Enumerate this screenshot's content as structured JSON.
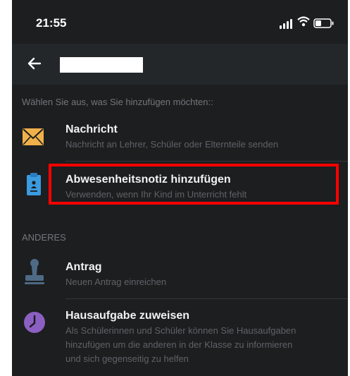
{
  "status_bar": {
    "time": "21:55"
  },
  "header": {
    "back_icon": "arrow-left-icon",
    "title_redacted": true
  },
  "prompt": "Wählen Sie aus, was Sie hinzufügen möchten::",
  "items_main": [
    {
      "title": "Nachricht",
      "subtitle": "Nachricht an Lehrer, Schüler oder Elternteile senden",
      "icon": "envelope-icon"
    },
    {
      "title": "Abwesenheitsnotiz hinzufügen",
      "subtitle": "Verwenden, wenn Ihr Kind im Unterricht fehlt",
      "icon": "clipboard-icon",
      "highlighted": true
    }
  ],
  "section_label": "ANDERES",
  "items_other": [
    {
      "title": "Antrag",
      "subtitle": "Neuen Antrag einreichen",
      "icon": "stamp-icon"
    },
    {
      "title": "Hausaufgabe zuweisen",
      "subtitle_lines": [
        "Als Schülerinnen und Schüler können Sie Hausaufgaben",
        "hinzufügen um die anderen in der Klasse zu informieren",
        "und sich gegenseitig zu helfen"
      ],
      "icon": "clock-icon"
    }
  ],
  "colors": {
    "background": "#1c1e20",
    "app_bar": "#24272a",
    "highlight": "#ff0000",
    "envelope": "#f0b04a",
    "clipboard": "#3b9be0",
    "stamp": "#4e6a85",
    "clock": "#8c5fc2"
  }
}
